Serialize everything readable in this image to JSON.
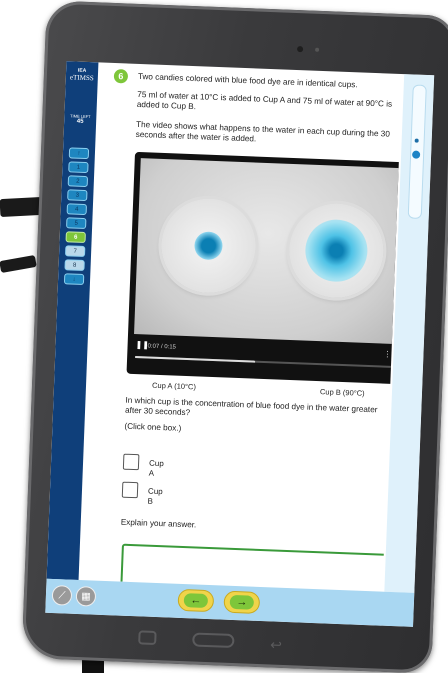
{
  "logo": {
    "org": "IEA",
    "brand": "eTIMSS"
  },
  "time_left": {
    "label": "TIME LEFT",
    "value": "45"
  },
  "question_nav": {
    "up_icon": "arrow-up-icon",
    "items": [
      "1",
      "2",
      "3",
      "4",
      "5",
      "6",
      "7",
      "8"
    ],
    "current": "6",
    "down_icon": "arrow-down-icon"
  },
  "question": {
    "number": "6",
    "intro": "Two candies colored with blue food dye are in identical cups.",
    "setup": "75 ml of water at 10°C is added to Cup A and 75 ml of water at 90°C is added to Cup B.",
    "video_text": "The video shows what happens to the water in each cup during the 30 seconds after the water is added.",
    "prompt": "In which cup is the concentration of blue food dye in the water greater after 30 seconds?",
    "instruction": "(Click one box.)",
    "options": [
      "Cup A",
      "Cup B"
    ],
    "explain": "Explain your answer."
  },
  "video": {
    "time": "0:07 / 0:15",
    "progress": 0.47,
    "play_state_icon": "pause-icon",
    "menu_icon": "more-vertical-icon",
    "cup_a_label": "Cup A (10°C)",
    "cup_b_label": "Cup B (90°C)"
  },
  "toolbar": {
    "ruler_icon": "ruler-icon",
    "calculator_icon": "calculator-icon",
    "back_icon": "arrow-left-icon",
    "next_icon": "arrow-right-icon"
  },
  "colors": {
    "sidebar": "#0f3f7a",
    "accent_green": "#7ec63a",
    "nav_yellow": "#f0d44a",
    "bottom_bar": "#a9d7f2",
    "dye_blue": "#0b7fb3"
  }
}
